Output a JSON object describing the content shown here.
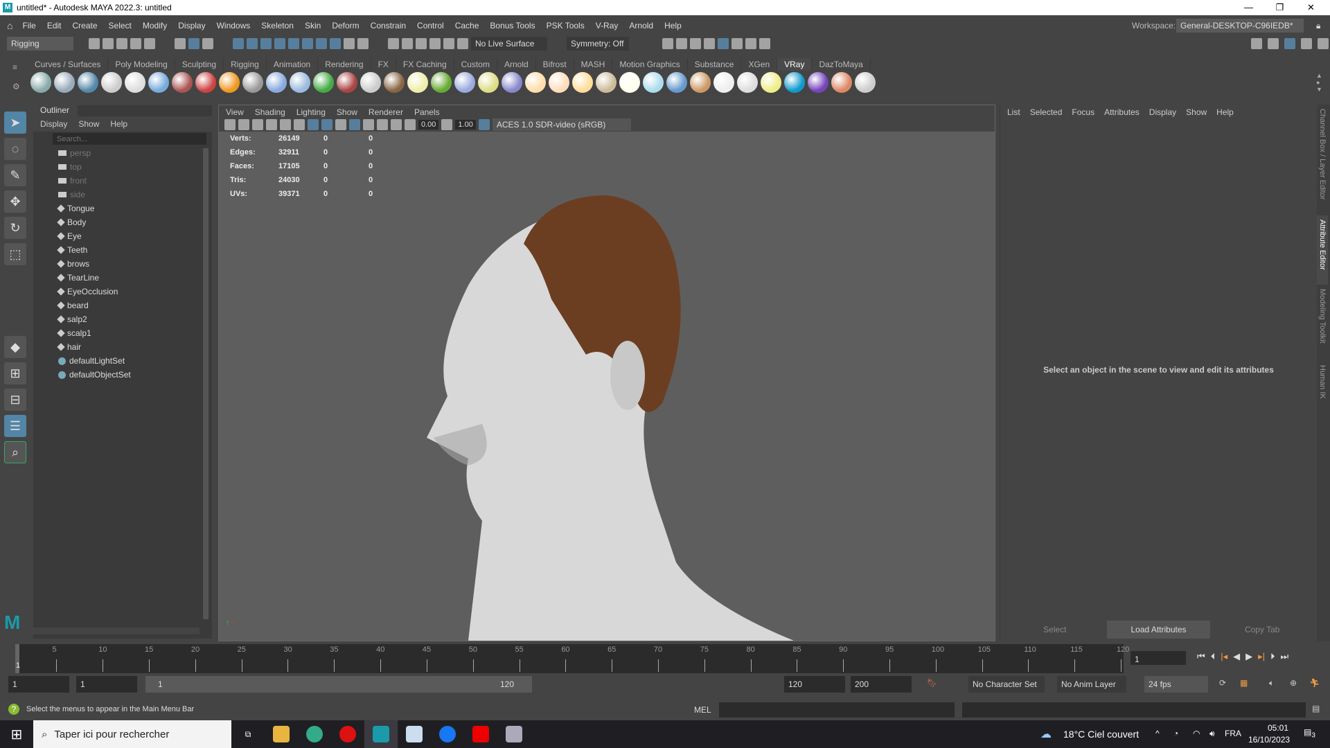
{
  "title": "untitled* - Autodesk MAYA 2022.3: untitled",
  "window_controls": {
    "minimize": "—",
    "maximize": "❐",
    "close": "✕"
  },
  "menu": [
    "File",
    "Edit",
    "Create",
    "Select",
    "Modify",
    "Display",
    "Windows",
    "Skeleton",
    "Skin",
    "Deform",
    "Constrain",
    "Control",
    "Cache",
    "Bonus Tools",
    "PSK Tools",
    "V-Ray",
    "Arnold",
    "Help"
  ],
  "workspace": {
    "label": "Workspace:",
    "value": "General-DESKTOP-C96IEDB*"
  },
  "status_line": {
    "menu_set": "Rigging",
    "live_surface": "No Live Surface",
    "symmetry": "Symmetry: Off"
  },
  "shelf_tabs": [
    {
      "label": "Curves / Surfaces"
    },
    {
      "label": "Poly Modeling"
    },
    {
      "label": "Sculpting"
    },
    {
      "label": "Rigging"
    },
    {
      "label": "Animation"
    },
    {
      "label": "Rendering"
    },
    {
      "label": "FX"
    },
    {
      "label": "FX Caching"
    },
    {
      "label": "Custom"
    },
    {
      "label": "Arnold"
    },
    {
      "label": "Bifrost"
    },
    {
      "label": "MASH"
    },
    {
      "label": "Motion Graphics"
    },
    {
      "label": "Substance"
    },
    {
      "label": "XGen"
    },
    {
      "label": "VRay",
      "active": true
    },
    {
      "label": "DazToMaya"
    }
  ],
  "shelf_icons": [
    {
      "name": "vray-settings-icon",
      "color": "#8aa"
    },
    {
      "name": "vray-batch-icon",
      "color": "#9ab"
    },
    {
      "name": "vray-list-icon",
      "color": "#58a"
    },
    {
      "name": "vray-plug-icon",
      "color": "#ccc"
    },
    {
      "name": "vray-vfb-icon",
      "color": "#ddd"
    },
    {
      "name": "vray-material-icon",
      "color": "#7ad"
    },
    {
      "name": "vray-camera-icon",
      "color": "#a55"
    },
    {
      "name": "vray-blend-icon",
      "color": "#c44"
    },
    {
      "name": "vray-fire-icon",
      "color": "#e92"
    },
    {
      "name": "vray-proxy-icon",
      "color": "#999"
    },
    {
      "name": "vray-sphere-icon",
      "color": "#8ad"
    },
    {
      "name": "vray-cone-icon",
      "color": "#9bd"
    },
    {
      "name": "vray-displace-icon",
      "color": "#4a4"
    },
    {
      "name": "vray-fur-icon",
      "color": "#a44"
    },
    {
      "name": "vray-decal-icon",
      "color": "#ccc"
    },
    {
      "name": "vray-texture-icon",
      "color": "#864"
    },
    {
      "name": "vray-dome-icon",
      "color": "#eea"
    },
    {
      "name": "vray-grass-icon",
      "color": "#6a3"
    },
    {
      "name": "vray-scatter-icon",
      "color": "#9ad"
    },
    {
      "name": "vray-spline-icon",
      "color": "#dd8"
    },
    {
      "name": "vray-lightsphere-icon",
      "color": "#88c"
    },
    {
      "name": "vray-dome-light-icon",
      "color": "#fda"
    },
    {
      "name": "vray-spot-icon",
      "color": "#fdb"
    },
    {
      "name": "vray-omni-icon",
      "color": "#fd9"
    },
    {
      "name": "vray-ies-icon",
      "color": "#cb9"
    },
    {
      "name": "vray-sun-icon",
      "color": "#ffe"
    },
    {
      "name": "vray-rect-light-icon",
      "color": "#ade"
    },
    {
      "name": "vray-sky-icon",
      "color": "#69c"
    },
    {
      "name": "vray-flag-icon",
      "color": "#c96"
    },
    {
      "name": "vray-checker-icon",
      "color": "#eee"
    },
    {
      "name": "vray-frame-buffer-icon",
      "color": "#ddd"
    },
    {
      "name": "vray-light-lister-icon",
      "color": "#ee8"
    },
    {
      "name": "vray-cloud-icon",
      "color": "#19c"
    },
    {
      "name": "vray-chaos-icon",
      "color": "#74b"
    },
    {
      "name": "vray-palette-icon",
      "color": "#d86"
    },
    {
      "name": "help-icon",
      "color": "#ccc"
    }
  ],
  "outliner": {
    "title": "Outliner",
    "menu": [
      "Display",
      "Show",
      "Help"
    ],
    "search_placeholder": "Search...",
    "items": [
      {
        "label": "persp",
        "type": "camera"
      },
      {
        "label": "top",
        "type": "camera"
      },
      {
        "label": "front",
        "type": "camera"
      },
      {
        "label": "side",
        "type": "camera"
      },
      {
        "label": "Tongue",
        "type": "mesh"
      },
      {
        "label": "Body",
        "type": "mesh"
      },
      {
        "label": "Eye",
        "type": "mesh"
      },
      {
        "label": "Teeth",
        "type": "mesh"
      },
      {
        "label": "brows",
        "type": "mesh"
      },
      {
        "label": "TearLine",
        "type": "mesh"
      },
      {
        "label": "EyeOcclusion",
        "type": "mesh"
      },
      {
        "label": "beard",
        "type": "mesh"
      },
      {
        "label": "salp2",
        "type": "mesh"
      },
      {
        "label": "scalp1",
        "type": "mesh"
      },
      {
        "label": "hair",
        "type": "mesh"
      },
      {
        "label": "defaultLightSet",
        "type": "set"
      },
      {
        "label": "defaultObjectSet",
        "type": "set"
      }
    ]
  },
  "viewport": {
    "menu": [
      "View",
      "Shading",
      "Lighting",
      "Show",
      "Renderer",
      "Panels"
    ],
    "exposure": "0.00",
    "gamma": "1.00",
    "color_space": "ACES 1.0 SDR-video (sRGB)",
    "hud": [
      [
        "Verts:",
        "26149",
        "0",
        "0"
      ],
      [
        "Edges:",
        "32911",
        "0",
        "0"
      ],
      [
        "Faces:",
        "17105",
        "0",
        "0"
      ],
      [
        "Tris:",
        "24030",
        "0",
        "0"
      ],
      [
        "UVs:",
        "39371",
        "0",
        "0"
      ]
    ]
  },
  "attribute_editor": {
    "menu": [
      "List",
      "Selected",
      "Focus",
      "Attributes",
      "Display",
      "Show",
      "Help"
    ],
    "message": "Select an object in the scene to view and edit its attributes",
    "buttons": [
      "Select",
      "Load Attributes",
      "Copy Tab"
    ]
  },
  "side_tabs": [
    "Channel Box / Layer Editor",
    "Attribute Editor",
    "Modeling Toolkit",
    "Human IK"
  ],
  "timeline": {
    "start": 1,
    "end": 120,
    "current_frame": "1",
    "current_marker": "1"
  },
  "range": {
    "start": "1",
    "playback_start": "1",
    "range_start_label": "1",
    "range_end_label": "120",
    "playback_end": "120",
    "end": "200",
    "character_set": "No Character Set",
    "anim_layer": "No Anim Layer",
    "fps": "24 fps"
  },
  "command": {
    "help": "Select the menus to appear in the Main Menu Bar",
    "lang": "MEL"
  },
  "taskbar": {
    "search": "Taper ici pour rechercher",
    "weather": "18°C  Ciel couvert",
    "lang": "FRA",
    "time": "05:01",
    "date": "16/10/2023",
    "notifications": "3"
  }
}
